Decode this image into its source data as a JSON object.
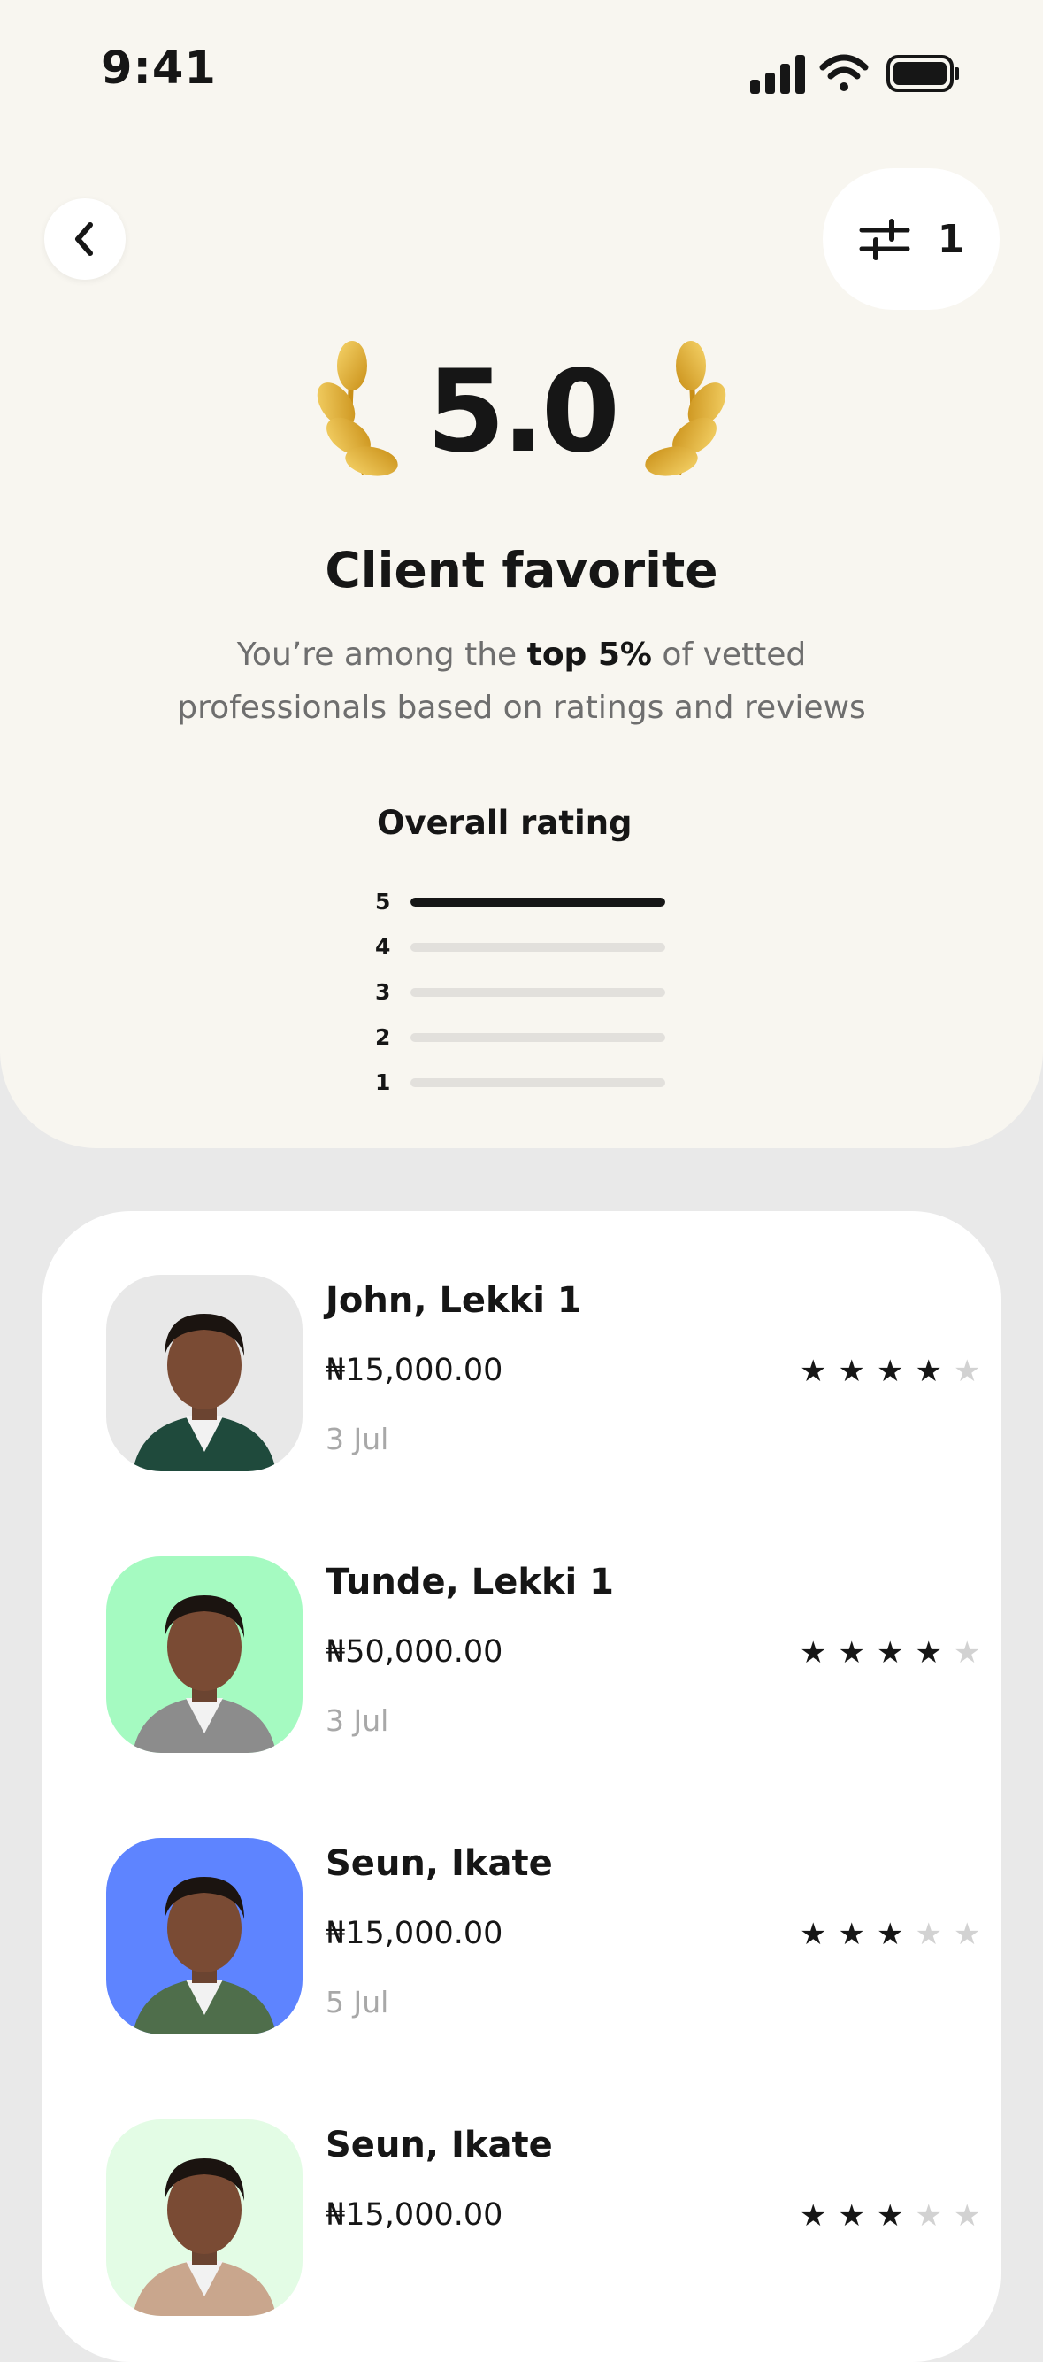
{
  "status_bar": {
    "time": "9:41",
    "icons": [
      "signal-icon",
      "wifi-icon",
      "battery-icon"
    ]
  },
  "header": {
    "back_icon": "chevron-left-icon",
    "filter_icon": "sliders-icon",
    "filter_count": "1"
  },
  "hero": {
    "score": "5.0",
    "badge_icon": "laurel-wreath-icon",
    "title": "Client favorite",
    "subtitle_pre": "You’re among the ",
    "subtitle_bold": "top 5%",
    "subtitle_post": " of vetted professionals based on ratings and reviews"
  },
  "overall": {
    "title": "Overall rating",
    "distribution": [
      {
        "label": "5",
        "fraction": 1.0
      },
      {
        "label": "4",
        "fraction": 0.0
      },
      {
        "label": "3",
        "fraction": 0.0
      },
      {
        "label": "2",
        "fraction": 0.0
      },
      {
        "label": "1",
        "fraction": 0.0
      }
    ]
  },
  "reviews": [
    {
      "name": "John, Lekki 1",
      "price": "₦15,000.00",
      "date": "3 Jul",
      "stars": 4,
      "avatar_bg": "#e8e8e8",
      "shirt": "#1f4a3c"
    },
    {
      "name": "Tunde, Lekki 1",
      "price": "₦50,000.00",
      "date": "3 Jul",
      "stars": 4,
      "avatar_bg": "#a5fac1",
      "shirt": "#8c8c8c"
    },
    {
      "name": "Seun, Ikate",
      "price": "₦15,000.00",
      "date": "5 Jul",
      "stars": 3,
      "avatar_bg": "#5e84ff",
      "shirt": "#4f6e4b"
    },
    {
      "name": "Seun, Ikate",
      "price": "₦15,000.00",
      "date": "",
      "stars": 3,
      "avatar_bg": "#e3fce5",
      "shirt": "#c9a68d"
    }
  ],
  "colors": {
    "panel_bg": "#f8f6f0",
    "page_bg": "#e9e9e9",
    "text": "#161616",
    "muted": "#6e6e6e",
    "gold": "#e0a92b"
  }
}
